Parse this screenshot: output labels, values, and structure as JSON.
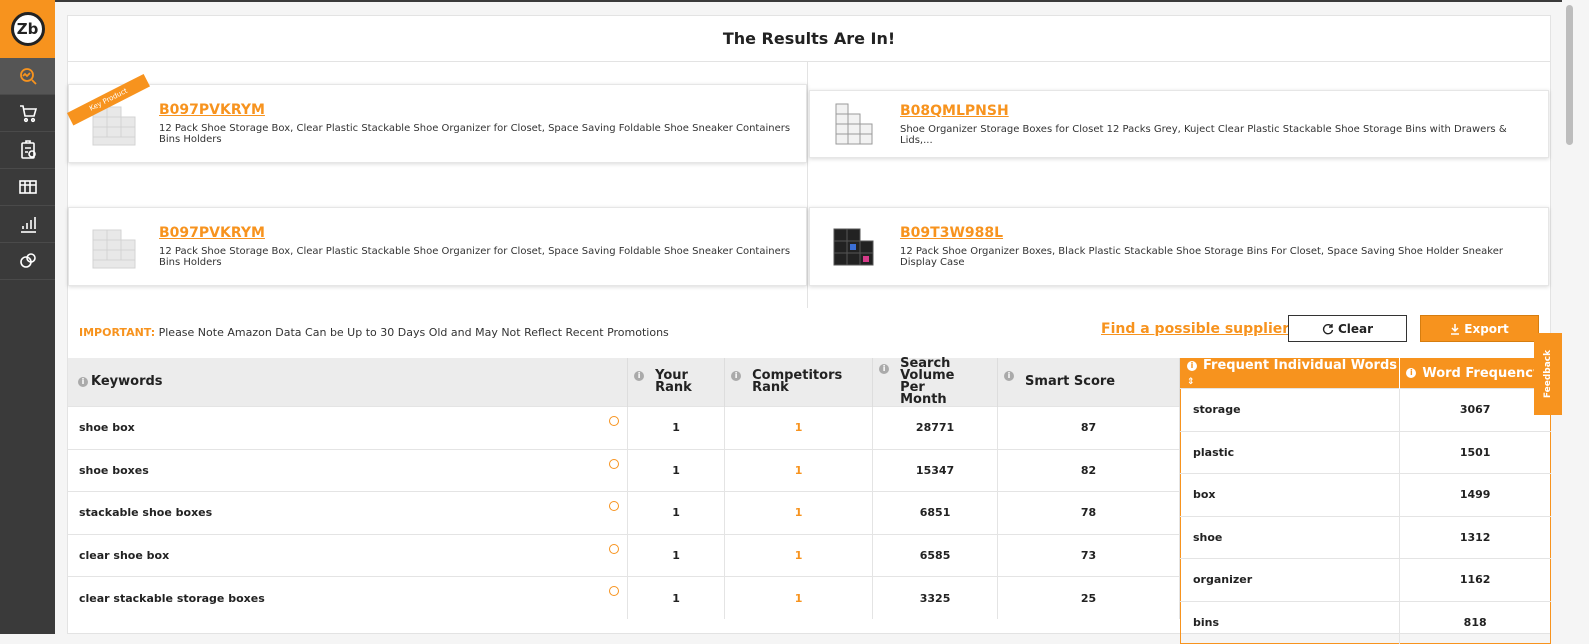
{
  "title": "The Results Are In!",
  "products": [
    {
      "asin": "B097PVKRYM",
      "desc": "12 Pack Shoe Storage Box, Clear Plastic Stackable Shoe Organizer for Closet, Space Saving Foldable Shoe Sneaker Containers Bins Holders",
      "ribbon": "Key Product"
    },
    {
      "asin": "B08QMLPNSH",
      "desc": "Shoe Organizer Storage Boxes for Closet 12 Packs Grey, Kuject Clear Plastic Stackable Shoe Storage Bins with Drawers & Lids,..."
    },
    {
      "asin": "B097PVKRYM",
      "desc": "12 Pack Shoe Storage Box, Clear Plastic Stackable Shoe Organizer for Closet, Space Saving Foldable Shoe Sneaker Containers Bins Holders"
    },
    {
      "asin": "B09T3W988L",
      "desc": "12 Pack Shoe Organizer Boxes, Black Plastic Stackable Shoe Storage Bins For Closet, Space Saving Shoe Holder Sneaker Display Case"
    }
  ],
  "notice": {
    "label": "IMPORTANT:",
    "text": " Please Note Amazon Data Can be Up to 30 Days Old and May Not Reflect Recent Promotions"
  },
  "actions": {
    "supplier": "Find a possible supplier",
    "clear": "Clear",
    "export": "Export"
  },
  "keywords_table": {
    "headers": [
      "Keywords",
      "Your Rank",
      "Competitors Rank",
      "Search Volume Per Month",
      "Smart Score"
    ],
    "rows": [
      {
        "keyword": "shoe box",
        "your_rank": "1",
        "comp_rank": "1",
        "volume": "28771",
        "score": "87"
      },
      {
        "keyword": "shoe boxes",
        "your_rank": "1",
        "comp_rank": "1",
        "volume": "15347",
        "score": "82"
      },
      {
        "keyword": "stackable shoe boxes",
        "your_rank": "1",
        "comp_rank": "1",
        "volume": "6851",
        "score": "78"
      },
      {
        "keyword": "clear shoe box",
        "your_rank": "1",
        "comp_rank": "1",
        "volume": "6585",
        "score": "73"
      },
      {
        "keyword": "clear stackable storage boxes",
        "your_rank": "1",
        "comp_rank": "1",
        "volume": "3325",
        "score": "25"
      }
    ]
  },
  "words_table": {
    "headers": [
      "Frequent Individual Words",
      "Word Frequency"
    ],
    "sort_glyph": "⇕",
    "rows": [
      {
        "word": "storage",
        "freq": "3067"
      },
      {
        "word": "plastic",
        "freq": "1501"
      },
      {
        "word": "box",
        "freq": "1499"
      },
      {
        "word": "shoe",
        "freq": "1312"
      },
      {
        "word": "organizer",
        "freq": "1162"
      },
      {
        "word": "bins",
        "freq": "818"
      }
    ]
  },
  "feedback": "Feedback",
  "colors": {
    "accent": "#f7931e",
    "sidebar": "#3a3a3a"
  }
}
